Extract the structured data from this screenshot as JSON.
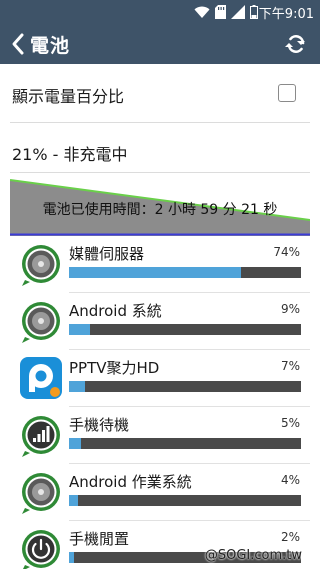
{
  "status_bar": {
    "time": "下午9:01",
    "wifi_icon": "wifi-icon",
    "sd_icon": "sd-card-icon",
    "signal_icon": "signal-icon",
    "battery_icon": "battery-icon"
  },
  "header": {
    "title": "電池",
    "back_icon": "back-chevron-icon",
    "refresh_icon": "refresh-icon"
  },
  "settings": {
    "show_percent_label": "顯示電量百分比",
    "show_percent_checked": false
  },
  "battery": {
    "status_text": "21% - 非充電中",
    "level_percent": 21,
    "usage_text": "電池已使用時間：2 小時 59 分 21 秒"
  },
  "colors": {
    "accent": "#3e5368",
    "bar_fill": "#4fa3d9",
    "bar_track": "#4a4a4a",
    "graph_line": "#6ad04a",
    "graph_area": "#8c8c8c"
  },
  "apps": [
    {
      "name": "媒體伺服器",
      "percent_label": "74%",
      "value": 74,
      "icon": "media-server-icon"
    },
    {
      "name": "Android 系統",
      "percent_label": "9%",
      "value": 9,
      "icon": "android-system-icon"
    },
    {
      "name": "PPTV聚力HD",
      "percent_label": "7%",
      "value": 7,
      "icon": "pptv-app-icon"
    },
    {
      "name": "手機待機",
      "percent_label": "5%",
      "value": 5,
      "icon": "cell-standby-icon"
    },
    {
      "name": "Android 作業系統",
      "percent_label": "4%",
      "value": 4,
      "icon": "android-os-icon"
    },
    {
      "name": "手機閒置",
      "percent_label": "2%",
      "value": 2,
      "icon": "phone-idle-icon"
    }
  ],
  "watermark": "@SOGI.com.tw"
}
